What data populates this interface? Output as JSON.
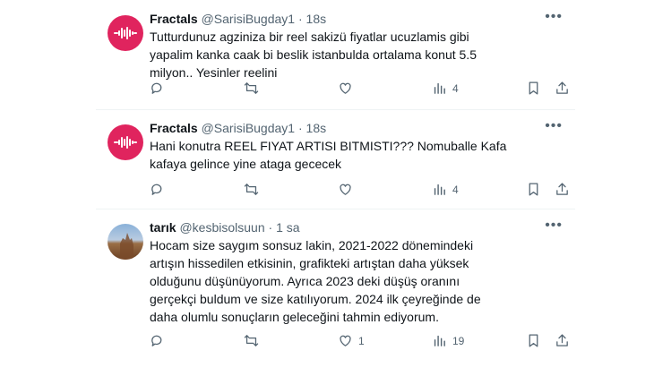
{
  "tweets": [
    {
      "name": "Fractals",
      "handle": "@SarisiBugday1",
      "dot": "·",
      "time": "18s",
      "text": "Tutturdunuz agziniza bir reel sakizü fiyatlar ucuzlamis gibi yapalim kanka caak bi beslik istanbulda ortalama konut 5.5 milyon.. Yesinler reelini",
      "replies": "",
      "retweets": "",
      "likes": "",
      "views": "4"
    },
    {
      "name": "Fractals",
      "handle": "@SarisiBugday1",
      "dot": "·",
      "time": "18s",
      "text": "Hani konutra REEL FIYAT ARTISI BITMISTI??? Nomuballe Kafa kafaya gelince yine ataga gececek",
      "replies": "",
      "retweets": "",
      "likes": "",
      "views": "4"
    },
    {
      "name": "tarık",
      "handle": "@kesbisolsuun",
      "dot": "·",
      "time": "1 sa",
      "text": "Hocam size saygım sonsuz lakin, 2021-2022 dönemindeki artışın hissedilen etkisinin, grafikteki artıştan daha yüksek olduğunu düşünüyorum. Ayrıca 2023 deki düşüş oranını gerçekçi buldum ve size katılıyorum. 2024 ilk çeyreğinde de daha olumlu sonuçların geleceğini tahmin ediyorum.",
      "replies": "",
      "retweets": "",
      "likes": "1",
      "views": "19"
    }
  ],
  "icons": {
    "more": "more-icon",
    "reply": "reply-icon",
    "retweet": "retweet-icon",
    "like": "like-icon",
    "views": "views-icon",
    "bookmark": "bookmark-icon",
    "share": "share-icon"
  },
  "colors": {
    "name": "#0f1419",
    "secondary": "#536471",
    "separator": "#eff3f4",
    "fractals_avatar": "#e0245e"
  }
}
